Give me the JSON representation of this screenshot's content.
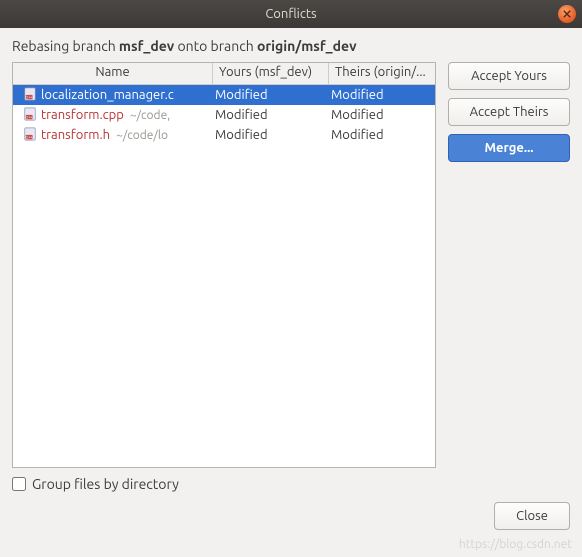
{
  "title": "Conflicts",
  "header": {
    "prefix": "Rebasing branch ",
    "branch1": "msf_dev",
    "mid": " onto branch ",
    "branch2": "origin/msf_dev"
  },
  "columns": {
    "name": "Name",
    "yours": "Yours (msf_dev)",
    "theirs": "Theirs (origin/..."
  },
  "rows": [
    {
      "file": "localization_manager.c",
      "path": "",
      "yours": "Modified",
      "theirs": "Modified",
      "selected": true
    },
    {
      "file": "transform.cpp",
      "path": "~/code,",
      "yours": "Modified",
      "theirs": "Modified",
      "selected": false
    },
    {
      "file": "transform.h",
      "path": "~/code/lo",
      "yours": "Modified",
      "theirs": "Modified",
      "selected": false
    }
  ],
  "buttons": {
    "accept_yours": "Accept Yours",
    "accept_theirs": "Accept Theirs",
    "merge": "Merge...",
    "close": "Close"
  },
  "checkbox": {
    "label": "Group files by directory"
  },
  "watermark": "https://blog.csdn.net"
}
